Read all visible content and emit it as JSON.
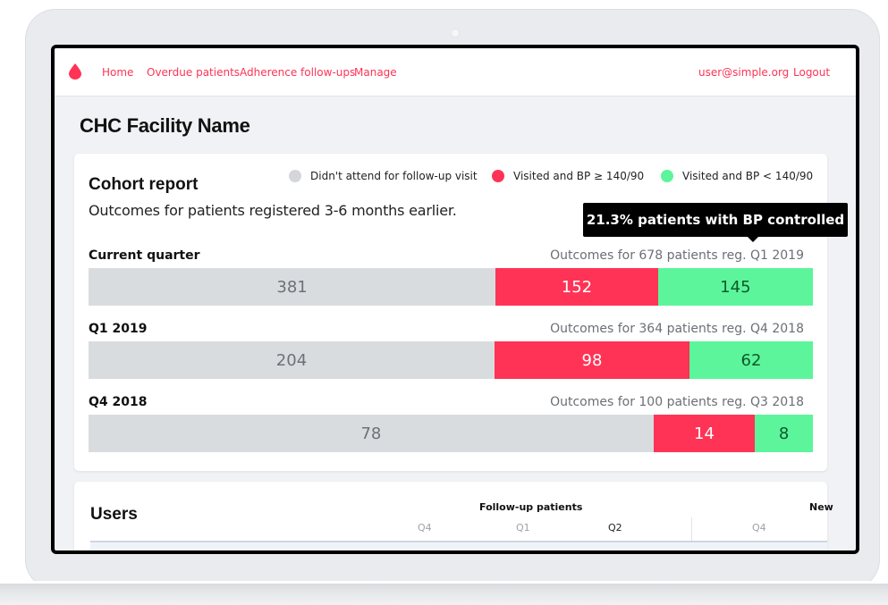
{
  "nav": {
    "links": [
      "Home",
      "Overdue patients",
      "Adherence follow-ups",
      "Manage"
    ],
    "user_email": "user@simple.org",
    "logout": "Logout",
    "brand_color": "#ff3355"
  },
  "page": {
    "title": "CHC Facility Name"
  },
  "cohort": {
    "title": "Cohort report",
    "subtitle": "Outcomes for patients registered 3-6 months earlier.",
    "legend": [
      {
        "label": "Didn't attend for follow-up visit",
        "color": "#d4d6d9"
      },
      {
        "label": "Visited and BP ≥ 140/90",
        "color": "#ff3355"
      },
      {
        "label": "Visited and BP < 140/90",
        "color": "#5cf59b"
      }
    ],
    "tooltip": "21.3%  patients with BP controlled",
    "rows": [
      {
        "label": "Current quarter",
        "caption": "Outcomes for 678 patients reg. Q1 2019",
        "missed": 381,
        "uncontrolled": 152,
        "controlled": 145
      },
      {
        "label": "Q1 2019",
        "caption": "Outcomes for 364 patients reg. Q4 2018",
        "missed": 204,
        "uncontrolled": 98,
        "controlled": 62
      },
      {
        "label": "Q4 2018",
        "caption": "Outcomes for 100 patients reg. Q3 2018",
        "missed": 78,
        "uncontrolled": 14,
        "controlled": 8
      }
    ]
  },
  "users": {
    "title": "Users",
    "group_followup": "Follow-up patients",
    "group_new": "New",
    "followup_cols": [
      "Q4",
      "Q1",
      "Q2"
    ],
    "new_cols": [
      "Q4"
    ]
  }
}
